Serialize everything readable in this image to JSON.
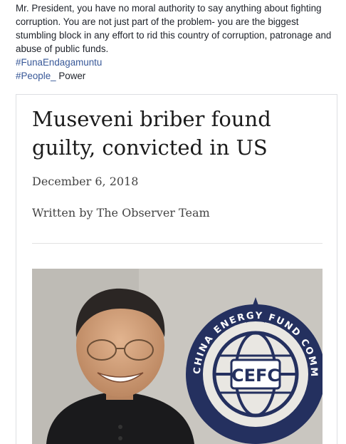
{
  "post": {
    "text": "Mr. President, you have no moral authority to say anything about fighting corruption. You are not just part of the problem- you are the biggest stumbling block in any effort to rid this country of corruption, patronage and abuse of public funds.",
    "hashtags": [
      {
        "tag": "#FunaEndagamuntu",
        "suffix": ""
      },
      {
        "tag": "#People_",
        "suffix": " Power"
      }
    ]
  },
  "article": {
    "headline": "Museveni briber found guilty, convicted in US",
    "date": "December 6, 2018",
    "byline": "Written by The Observer Team",
    "image": {
      "logo_text": "CEFC",
      "ring_text_top": "CHINA ENERGY FUND COMMITTEE"
    }
  },
  "colors": {
    "link": "#385898",
    "text": "#1d2129",
    "wall": "#c9c6c0",
    "logo_navy": "#1f2d5a"
  }
}
